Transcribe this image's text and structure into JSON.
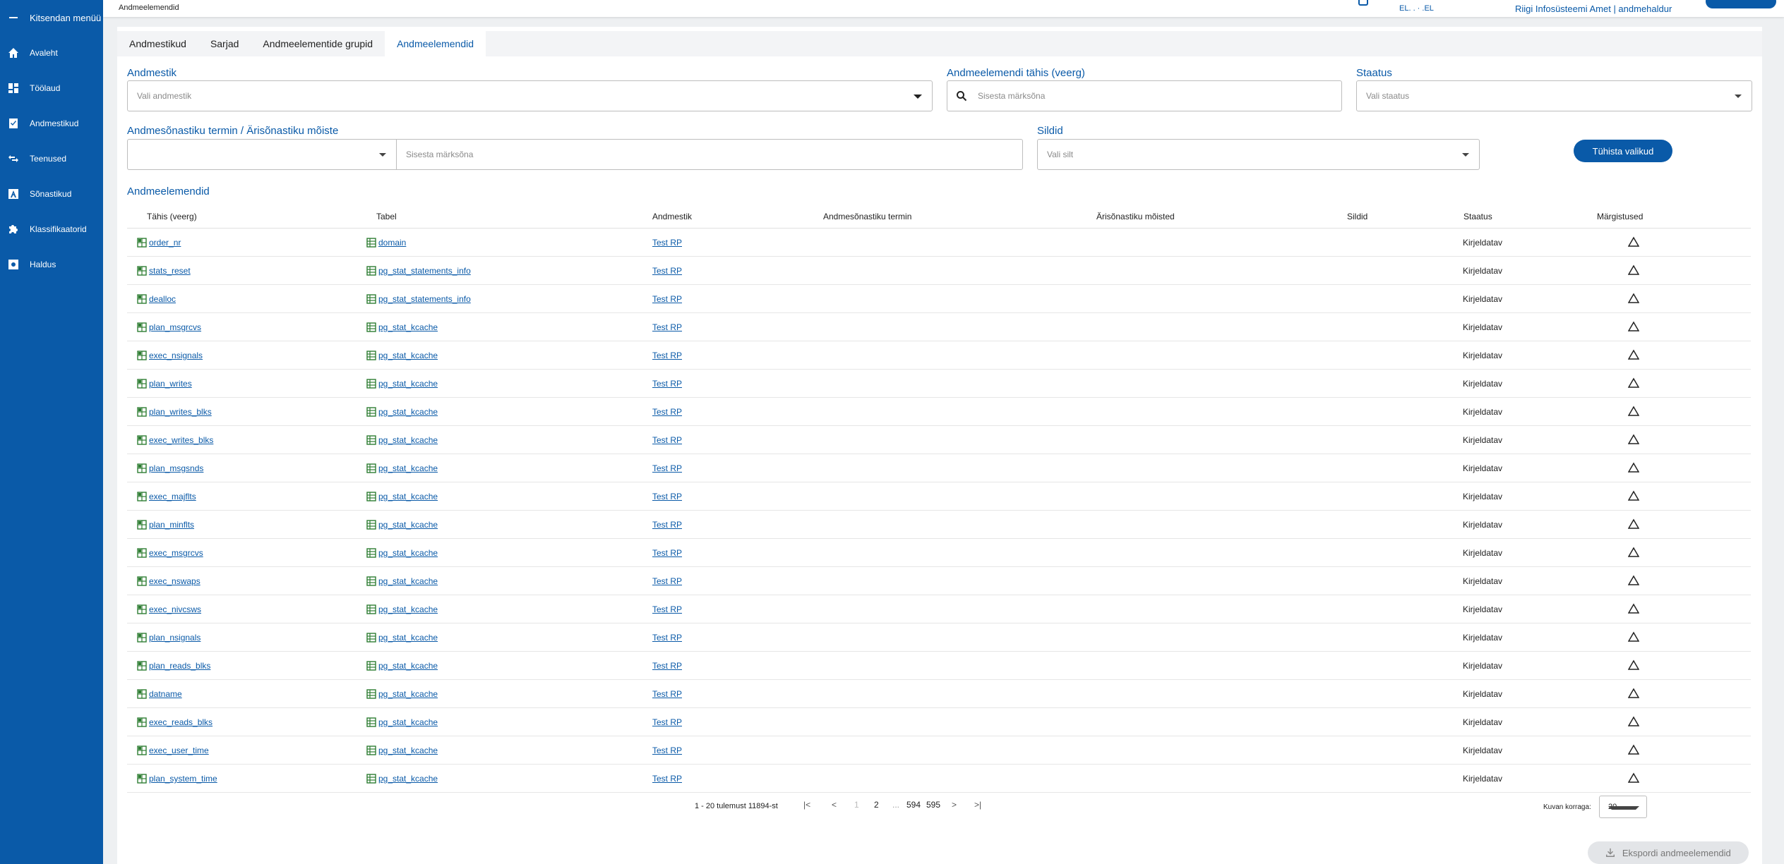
{
  "sidebar": {
    "items": [
      {
        "icon": "minus-icon",
        "label": "Kitsendan menüü"
      },
      {
        "icon": "home-icon",
        "label": "Avaleht"
      },
      {
        "icon": "dashboard-icon",
        "label": "Töölaud"
      },
      {
        "icon": "checkbox-icon",
        "label": "Andmestikud"
      },
      {
        "icon": "swap-icon",
        "label": "Teenused"
      },
      {
        "icon": "dictionary-icon",
        "label": "Sõnastikud"
      },
      {
        "icon": "puzzle-icon",
        "label": "Klassifikaatorid"
      },
      {
        "icon": "settings-icon",
        "label": "Haldus"
      }
    ]
  },
  "topbar": {
    "breadcrumb": "Andmeelemendid",
    "language": "EL.   .   ·   .EL",
    "org": "Riigi Infosüsteemi Amet | andmehaldur"
  },
  "tabs": [
    "Andmestikud",
    "Sarjad",
    "Andmeelementide grupid",
    "Andmeelemendid"
  ],
  "active_tab": 3,
  "filters": {
    "dataset_label": "Andmestik",
    "dataset_placeholder": "Vali andmestik",
    "column_label": "Andmeelemendi tähis (veerg)",
    "column_placeholder": "Sisesta märksõna",
    "status_label": "Staatus",
    "status_placeholder": "Vali staatus",
    "term_label": "Andmesõnastiku termin / Ärisõnastiku mõiste",
    "term_placeholder": "Sisesta märksõna",
    "tags_label": "Sildid",
    "tags_placeholder": "Vali silt",
    "clear_button": "Tühista valikud"
  },
  "section_title": "Andmeelemendid",
  "table": {
    "headers": [
      "Tähis (veerg)",
      "Tabel",
      "Andmestik",
      "Andmesõnastiku termin",
      "Ärisõnastiku mõisted",
      "Sildid",
      "Staatus",
      "Märgistused"
    ],
    "rows": [
      {
        "column": "order_nr",
        "table": "domain",
        "dataset": "Test RP",
        "status": "Kirjeldatav"
      },
      {
        "column": "stats_reset",
        "table": "pg_stat_statements_info",
        "dataset": "Test RP",
        "status": "Kirjeldatav"
      },
      {
        "column": "dealloc",
        "table": "pg_stat_statements_info",
        "dataset": "Test RP",
        "status": "Kirjeldatav"
      },
      {
        "column": "plan_msgrcvs",
        "table": "pg_stat_kcache",
        "dataset": "Test RP",
        "status": "Kirjeldatav"
      },
      {
        "column": "exec_nsignals",
        "table": "pg_stat_kcache",
        "dataset": "Test RP",
        "status": "Kirjeldatav"
      },
      {
        "column": "plan_writes",
        "table": "pg_stat_kcache",
        "dataset": "Test RP",
        "status": "Kirjeldatav"
      },
      {
        "column": "plan_writes_blks",
        "table": "pg_stat_kcache",
        "dataset": "Test RP",
        "status": "Kirjeldatav"
      },
      {
        "column": "exec_writes_blks",
        "table": "pg_stat_kcache",
        "dataset": "Test RP",
        "status": "Kirjeldatav"
      },
      {
        "column": "plan_msgsnds",
        "table": "pg_stat_kcache",
        "dataset": "Test RP",
        "status": "Kirjeldatav"
      },
      {
        "column": "exec_majflts",
        "table": "pg_stat_kcache",
        "dataset": "Test RP",
        "status": "Kirjeldatav"
      },
      {
        "column": "plan_minflts",
        "table": "pg_stat_kcache",
        "dataset": "Test RP",
        "status": "Kirjeldatav"
      },
      {
        "column": "exec_msgrcvs",
        "table": "pg_stat_kcache",
        "dataset": "Test RP",
        "status": "Kirjeldatav"
      },
      {
        "column": "exec_nswaps",
        "table": "pg_stat_kcache",
        "dataset": "Test RP",
        "status": "Kirjeldatav"
      },
      {
        "column": "exec_nivcsws",
        "table": "pg_stat_kcache",
        "dataset": "Test RP",
        "status": "Kirjeldatav"
      },
      {
        "column": "plan_nsignals",
        "table": "pg_stat_kcache",
        "dataset": "Test RP",
        "status": "Kirjeldatav"
      },
      {
        "column": "plan_reads_blks",
        "table": "pg_stat_kcache",
        "dataset": "Test RP",
        "status": "Kirjeldatav"
      },
      {
        "column": "datname",
        "table": "pg_stat_kcache",
        "dataset": "Test RP",
        "status": "Kirjeldatav"
      },
      {
        "column": "exec_reads_blks",
        "table": "pg_stat_kcache",
        "dataset": "Test RP",
        "status": "Kirjeldatav"
      },
      {
        "column": "exec_user_time",
        "table": "pg_stat_kcache",
        "dataset": "Test RP",
        "status": "Kirjeldatav"
      },
      {
        "column": "plan_system_time",
        "table": "pg_stat_kcache",
        "dataset": "Test RP",
        "status": "Kirjeldatav"
      }
    ]
  },
  "pagination": {
    "summary": "1 - 20 tulemust 11894-st",
    "pages": [
      "1",
      "2",
      "...",
      "594",
      "595"
    ],
    "per_page_label": "Kuvan korraga:",
    "per_page_value": "20"
  },
  "export_button": "Ekspordi andmeelemendid",
  "colors": {
    "primary": "#0a5aa8",
    "sidebar": "#0a5aa8"
  }
}
